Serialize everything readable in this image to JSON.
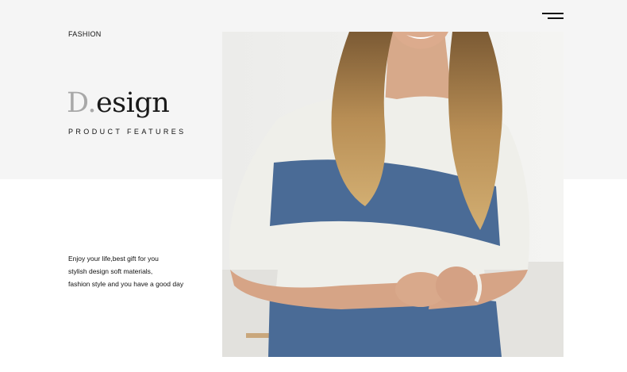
{
  "header": {
    "eyebrow": "FASHION",
    "menu_icon": "hamburger-menu-icon"
  },
  "hero": {
    "title_initial": "D",
    "title_dot": ".",
    "title_rest": "esign",
    "subtitle": "PRODUCT FEATURES"
  },
  "description": {
    "lines": [
      "Enjoy your life,best gift for you",
      "stylish design soft materials,",
      "fashion style and you have a good day"
    ]
  },
  "colors": {
    "band": "#f5f5f5",
    "accent_gray": "#a8a8a8",
    "sweater_blue": "#4a6b96",
    "sweater_white": "#efefea"
  }
}
